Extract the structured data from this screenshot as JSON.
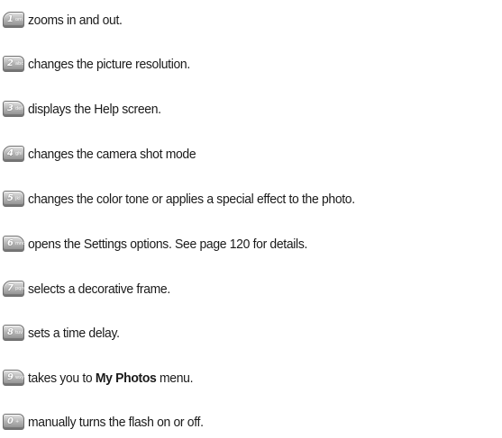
{
  "items": [
    {
      "key": "1",
      "letters": "om",
      "text": "zooms in and out."
    },
    {
      "key": "2",
      "letters": "abc",
      "text": "changes the picture resolution."
    },
    {
      "key": "3",
      "letters": "def",
      "text": "displays the Help screen."
    },
    {
      "key": "4",
      "letters": "ghi",
      "text": "changes the camera shot mode"
    },
    {
      "key": "5",
      "letters": "jkl",
      "text": "changes the color tone or applies a special effect to the photo."
    },
    {
      "key": "6",
      "letters": "mno",
      "text": "opens the Settings options. See page 120 for details."
    },
    {
      "key": "7",
      "letters": "pqrs",
      "text": "selects a decorative frame."
    },
    {
      "key": "8",
      "letters": "tuv",
      "text": "sets a time delay."
    },
    {
      "key": "9",
      "letters": "wxyz",
      "text_before": "takes you to ",
      "bold": "My Photos",
      "text_after": " menu."
    },
    {
      "key": "0",
      "letters": "+",
      "text": "manually turns the flash on or off."
    }
  ]
}
